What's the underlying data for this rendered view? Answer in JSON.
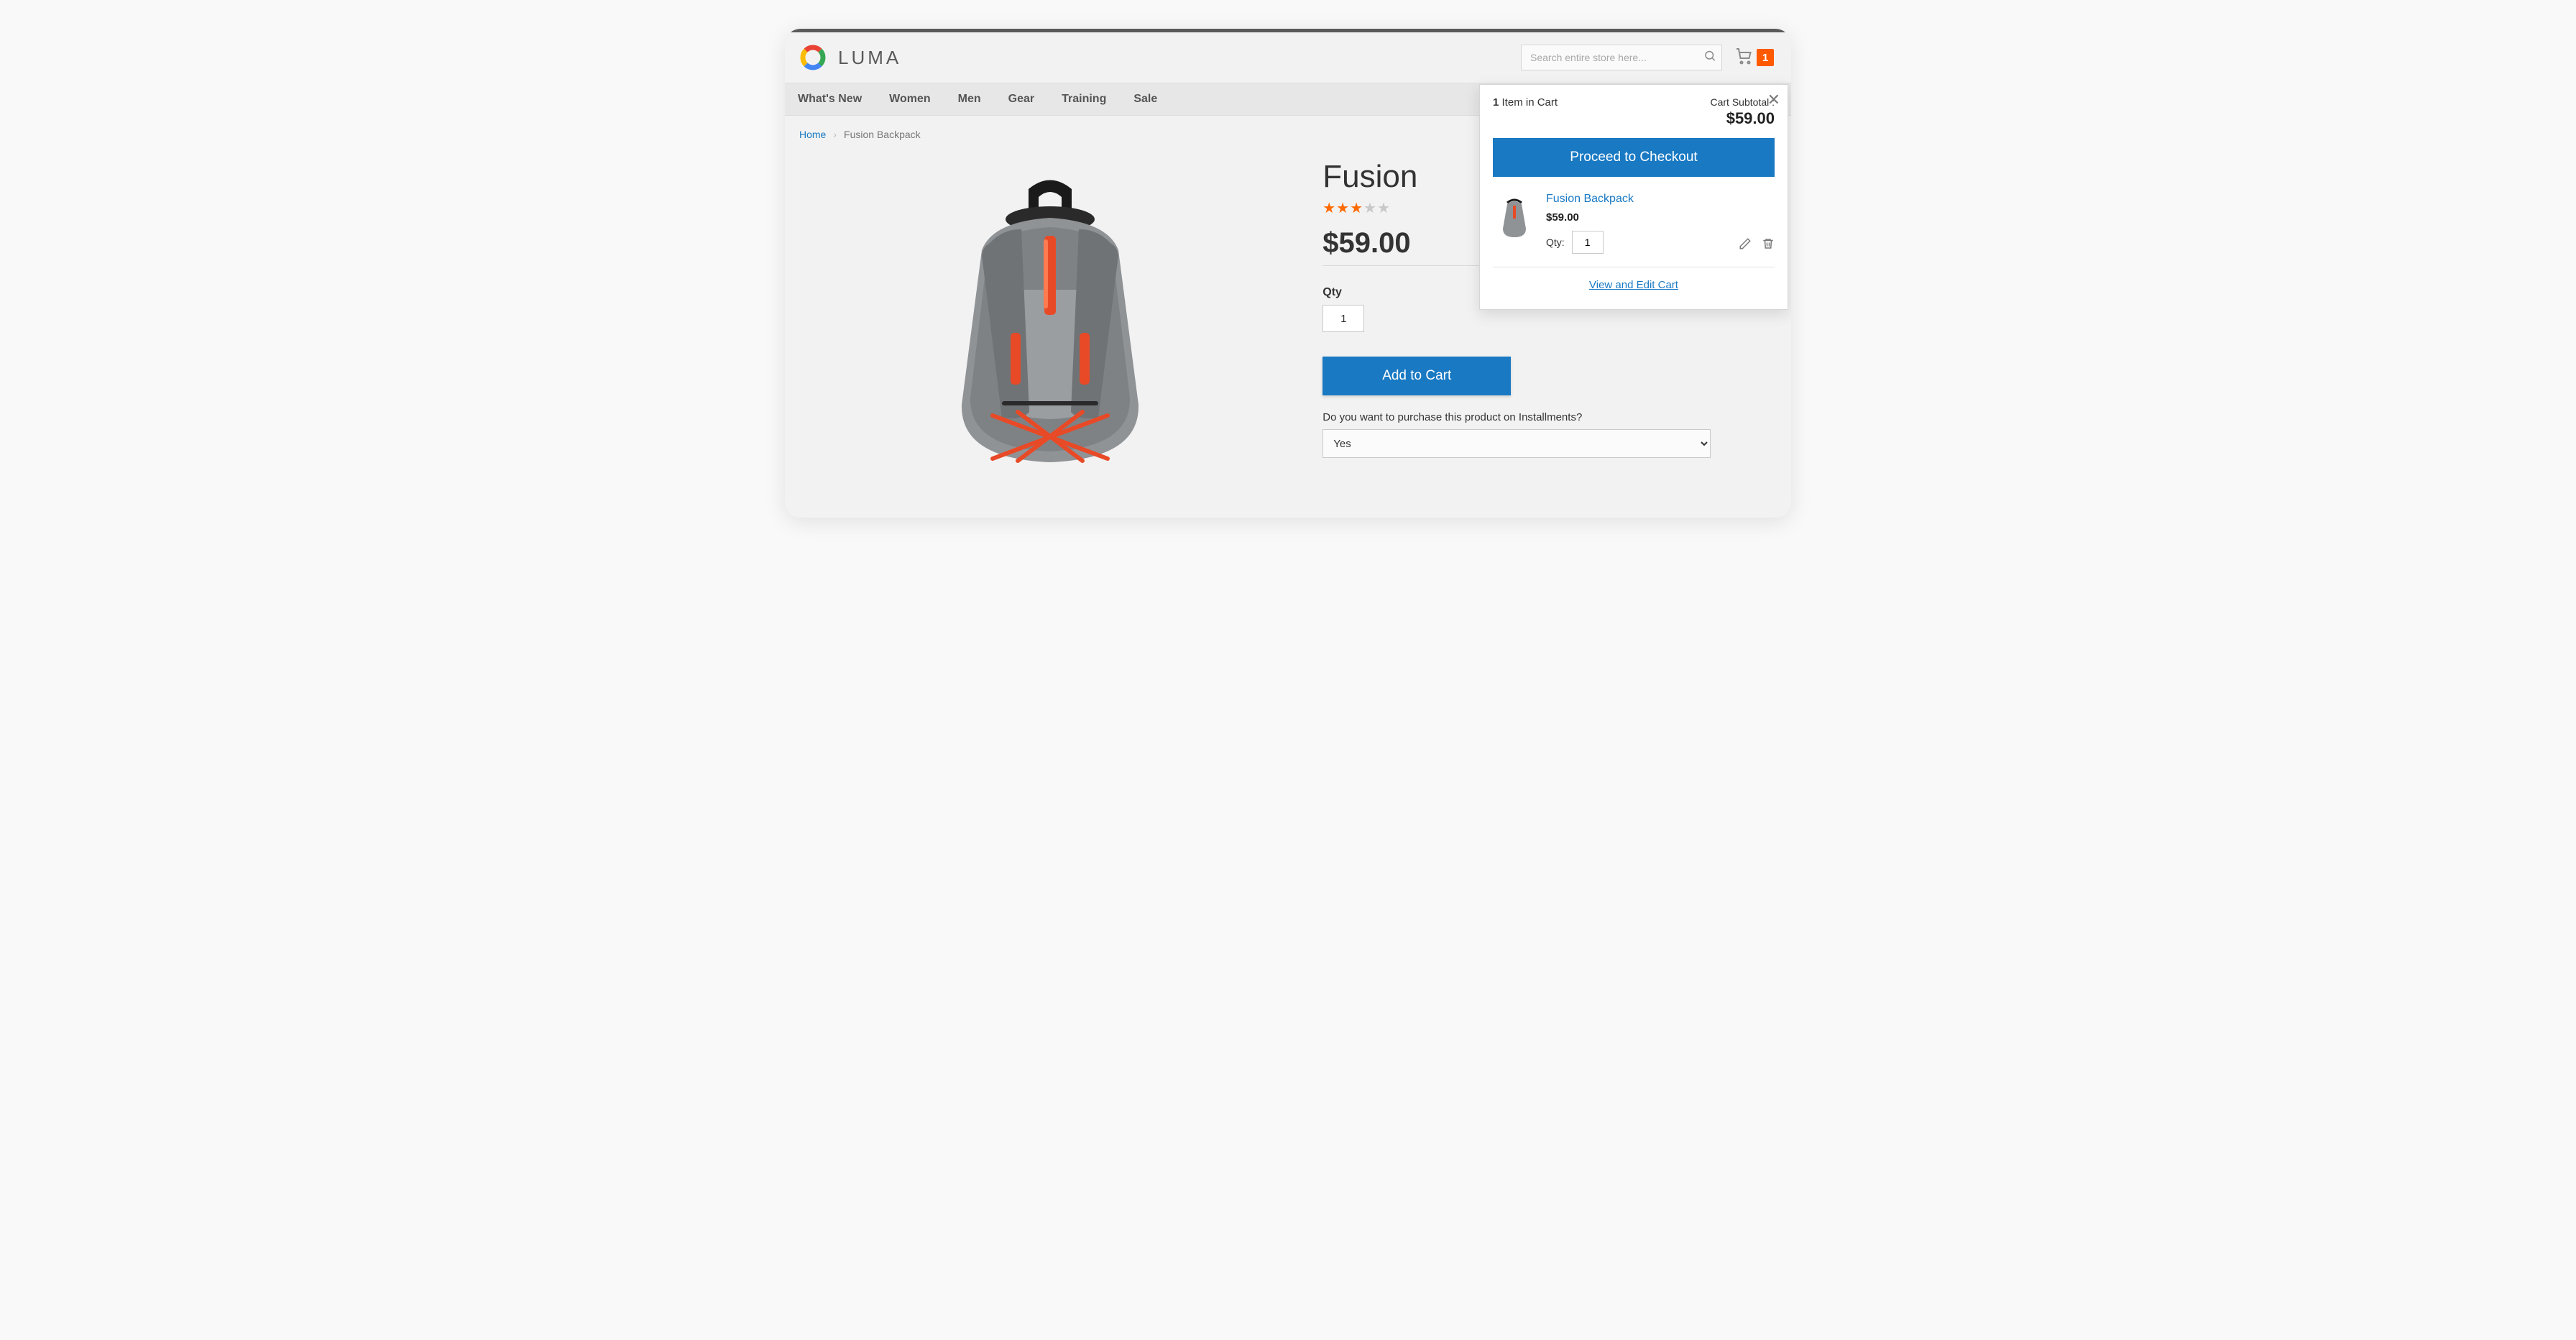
{
  "header": {
    "brand": "LUMA",
    "search_placeholder": "Search entire store here...",
    "cart_count": "1"
  },
  "nav": {
    "items": [
      "What's New",
      "Women",
      "Men",
      "Gear",
      "Training",
      "Sale"
    ]
  },
  "breadcrumb": {
    "home": "Home",
    "current": "Fusion Backpack"
  },
  "product": {
    "title": "Fusion",
    "rating": 3,
    "price": "$59.00",
    "qty_label": "Qty",
    "qty_value": "1",
    "add_to_cart": "Add to Cart",
    "installments_label": "Do you want to purchase this product on Installments?",
    "installments_selected": "Yes"
  },
  "minicart": {
    "items_count": "1",
    "items_suffix": "Item in Cart",
    "subtotal_label": "Cart Subtotal :",
    "subtotal_amount": "$59.00",
    "checkout_label": "Proceed to Checkout",
    "item": {
      "name": "Fusion Backpack",
      "price": "$59.00",
      "qty_label": "Qty:",
      "qty_value": "1"
    },
    "view_cart": "View and Edit Cart"
  }
}
